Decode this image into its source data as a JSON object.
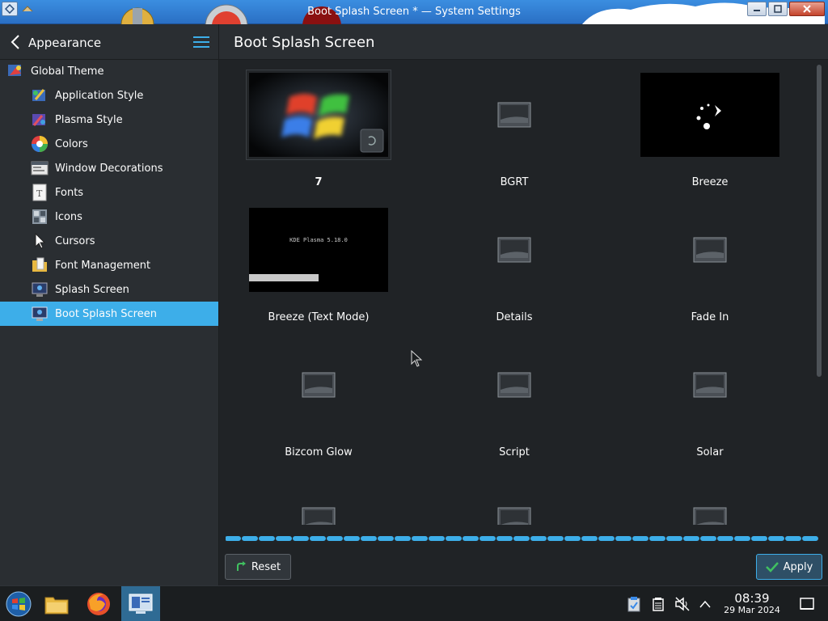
{
  "window": {
    "title": "Boot Splash Screen * — System Settings"
  },
  "sidebar": {
    "title": "Appearance",
    "items": [
      {
        "label": "Global Theme",
        "icon": "global-theme-icon"
      },
      {
        "label": "Application Style",
        "icon": "application-style-icon"
      },
      {
        "label": "Plasma Style",
        "icon": "plasma-style-icon"
      },
      {
        "label": "Colors",
        "icon": "colors-icon"
      },
      {
        "label": "Window Decorations",
        "icon": "window-decorations-icon"
      },
      {
        "label": "Fonts",
        "icon": "fonts-icon"
      },
      {
        "label": "Icons",
        "icon": "icons-icon"
      },
      {
        "label": "Cursors",
        "icon": "cursors-icon"
      },
      {
        "label": "Font Management",
        "icon": "font-management-icon"
      },
      {
        "label": "Splash Screen",
        "icon": "splash-screen-icon"
      },
      {
        "label": "Boot Splash Screen",
        "icon": "boot-splash-screen-icon",
        "active": true
      }
    ]
  },
  "main": {
    "title": "Boot Splash Screen",
    "themes": [
      {
        "label": "7",
        "preview": "windows-logo"
      },
      {
        "label": "BGRT",
        "preview": "placeholder"
      },
      {
        "label": "Breeze",
        "preview": "breeze-spinner"
      },
      {
        "label": "Breeze (Text Mode)",
        "preview": "text-mode",
        "preview_text": "KDE Plasma 5.18.0"
      },
      {
        "label": "Details",
        "preview": "placeholder"
      },
      {
        "label": "Fade In",
        "preview": "placeholder"
      },
      {
        "label": "Bizcom Glow",
        "preview": "placeholder"
      },
      {
        "label": "Script",
        "preview": "placeholder"
      },
      {
        "label": "Solar",
        "preview": "placeholder"
      },
      {
        "label": "",
        "preview": "placeholder"
      },
      {
        "label": "",
        "preview": "placeholder"
      },
      {
        "label": "",
        "preview": "placeholder"
      }
    ]
  },
  "footer": {
    "reset_label": "Reset",
    "apply_label": "Apply"
  },
  "taskbar": {
    "apps": [
      "start-orb-icon",
      "file-manager-icon",
      "firefox-icon",
      "system-settings-icon"
    ],
    "tray": [
      "clipboard-icon",
      "notes-icon",
      "volume-muted-icon",
      "chevron-up-icon"
    ],
    "time": "08:39",
    "date": "29 Mar 2024"
  },
  "colors": {
    "accent": "#3daee9",
    "background": "#202326",
    "sidebar": "#2a2e32"
  }
}
